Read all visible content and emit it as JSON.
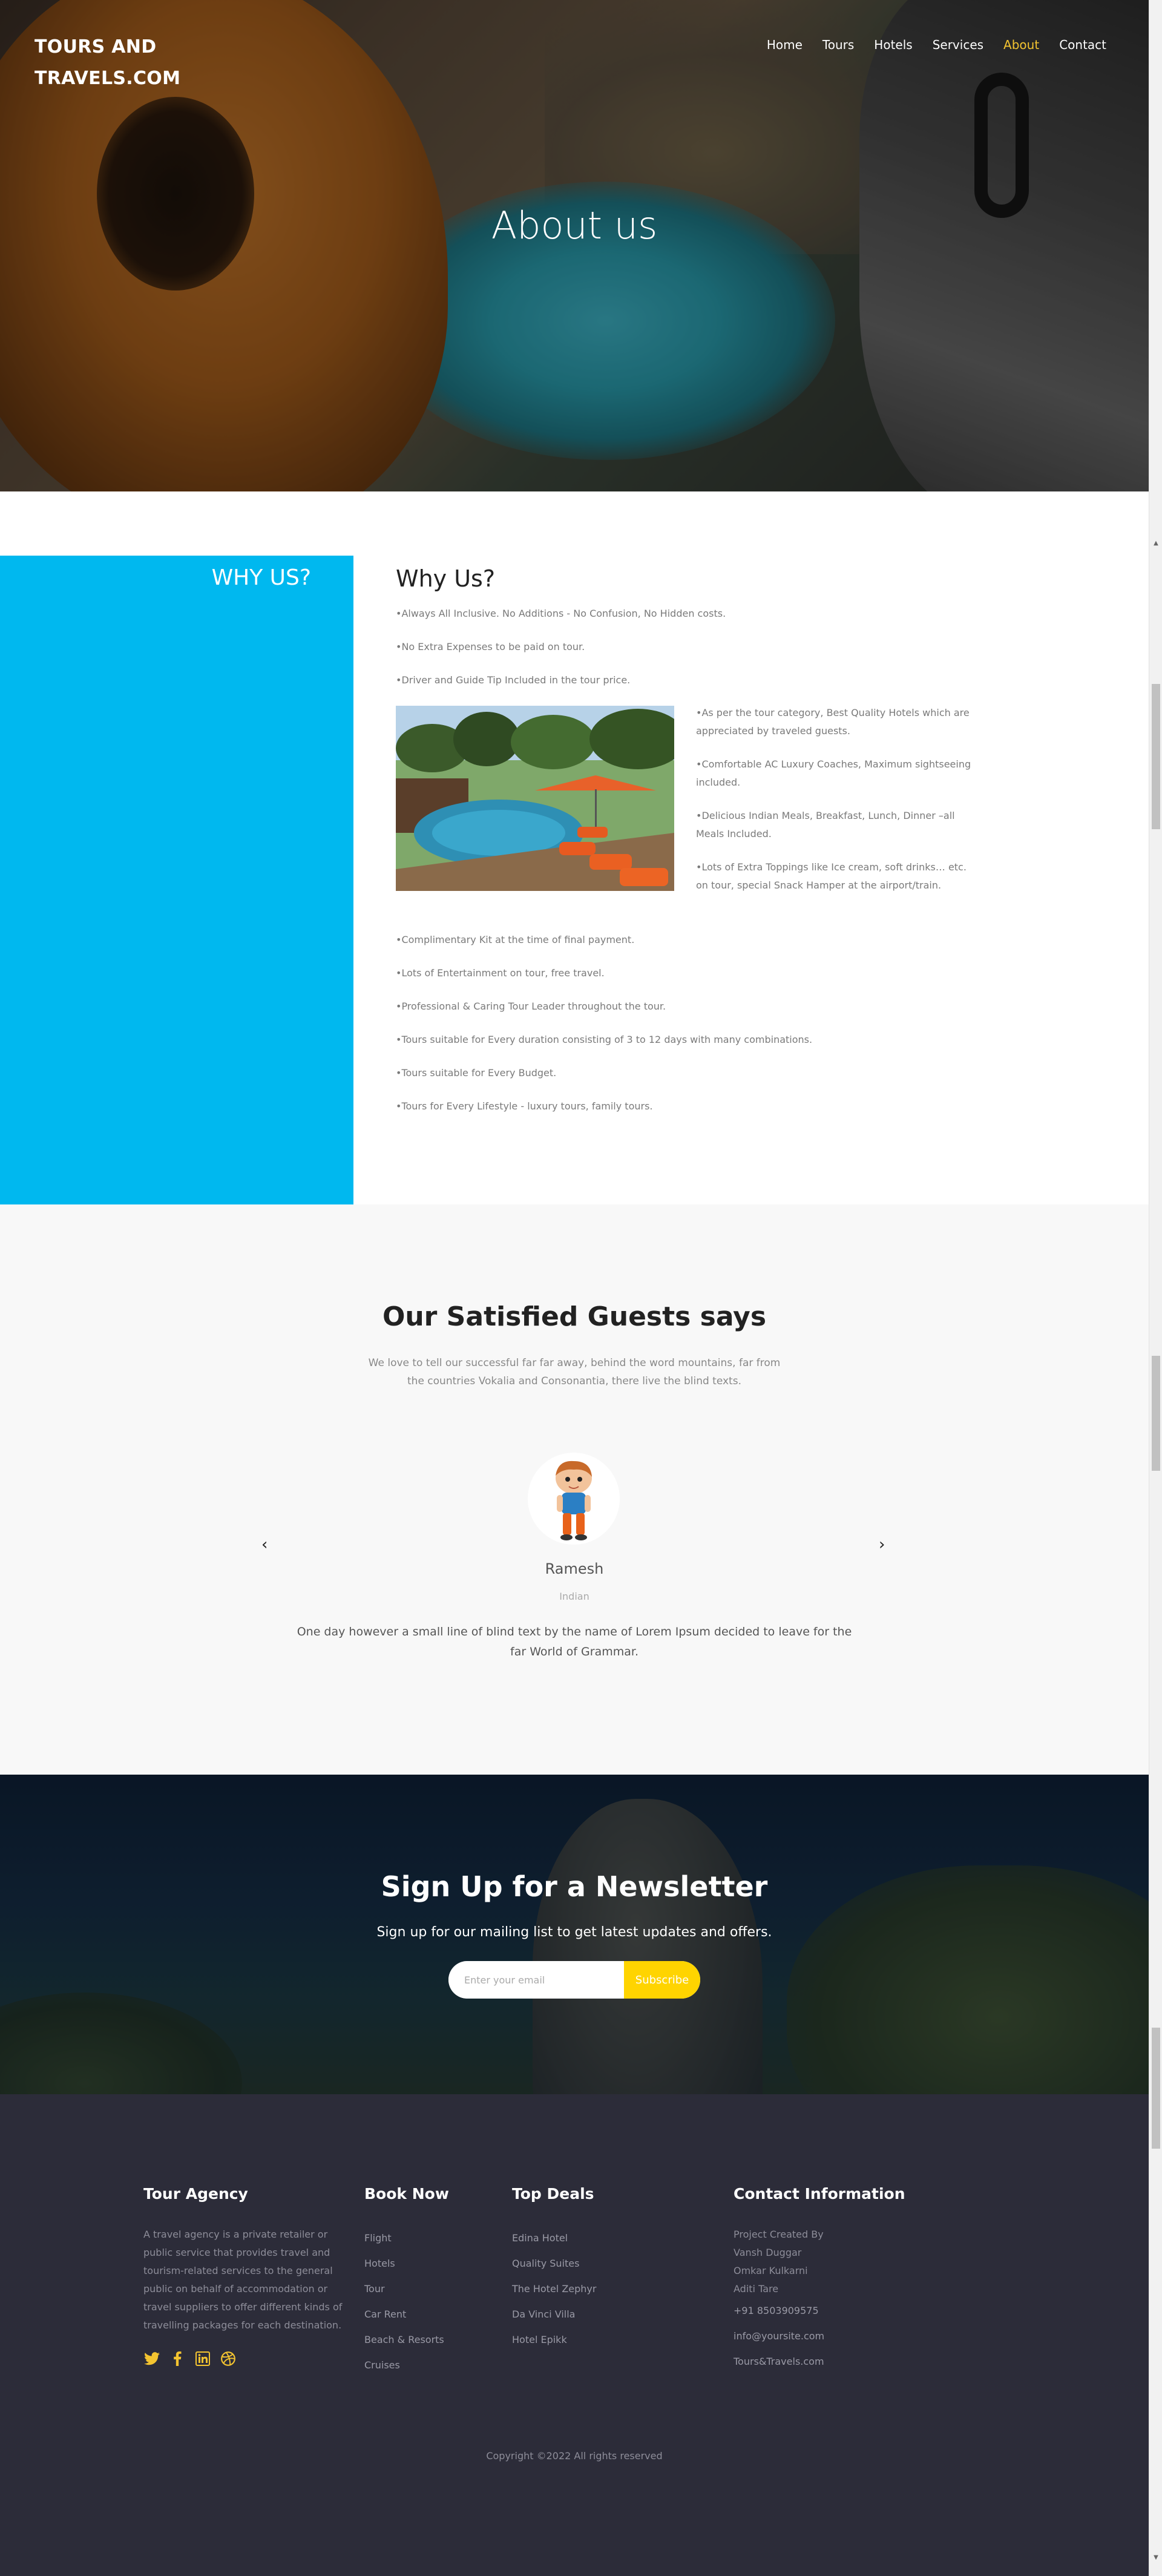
{
  "header": {
    "brand": "TOURS AND TRAVELS.COM",
    "nav": [
      "Home",
      "Tours",
      "Hotels",
      "Services",
      "About",
      "Contact"
    ],
    "active_nav": "About",
    "hero_title": "About us"
  },
  "why_us": {
    "side_title": "WHY US?",
    "title": "Why Us?",
    "list_top": [
      "•Always All Inclusive. No Additions - No Confusion, No Hidden costs.",
      "•No Extra Expenses to be paid on tour.",
      "•Driver and Guide Tip Included in the tour price."
    ],
    "list_side": [
      "•As per the tour category, Best Quality Hotels which are appreciated by traveled guests.",
      "•Comfortable AC Luxury Coaches, Maximum sightseeing included.",
      "•Delicious Indian Meals, Breakfast, Lunch, Dinner –all Meals Included.",
      "•Lots of Extra Toppings like Ice cream, soft drinks… etc. on tour, special Snack Hamper at the airport/train."
    ],
    "list_bottom": [
      "•Complimentary Kit at the time of final payment.",
      "•Lots of Entertainment on tour, free travel.",
      "•Professional & Caring Tour Leader throughout the tour.",
      "•Tours suitable for Every duration consisting of 3 to 12 days with many combinations.",
      "•Tours suitable for Every Budget.",
      "•Tours for Every Lifestyle - luxury tours, family tours."
    ]
  },
  "testimonial": {
    "title": "Our Satisfied Guests says",
    "subtitle": "We love to tell our successful far far away, behind the word mountains, far from the countries Vokalia and Consonantia, there live the blind texts.",
    "prev": "‹",
    "next": "›",
    "name": "Ramesh",
    "origin": "Indian",
    "quote": "One day however a small line of blind text by the name of Lorem Ipsum decided to leave for the far World of Grammar."
  },
  "newsletter": {
    "title": "Sign Up for a Newsletter",
    "subtitle": "Sign up for our mailing list to get latest updates and offers.",
    "placeholder": "Enter your email",
    "button": "Subscribe"
  },
  "footer": {
    "agency_title": "Tour Agency",
    "agency_text": "A travel agency is a private retailer or public service that provides travel and tourism-related services to the general public on behalf of accommodation or travel suppliers to offer different kinds of travelling packages for each destination.",
    "social_icons": [
      "twitter-icon",
      "facebook-icon",
      "linkedin-icon",
      "dribbble-icon"
    ],
    "book_title": "Book Now",
    "book_links": [
      "Flight",
      "Hotels",
      "Tour",
      "Car Rent",
      "Beach & Resorts",
      "Cruises"
    ],
    "deals_title": "Top Deals",
    "deals_links": [
      "Edina Hotel",
      "Quality Suites",
      "The Hotel Zephyr",
      "Da Vinci Villa",
      "Hotel Epikk"
    ],
    "contact_title": "Contact Information",
    "contact_lines": [
      "Project Created By",
      "Vansh Duggar",
      "Omkar Kulkarni",
      "Aditi Tare"
    ],
    "contact_items": [
      "+91 8503909575",
      "info@yoursite.com",
      "Tours&Travels.com"
    ],
    "copyright": "Copyright ©2022 All rights reserved"
  },
  "colors": {
    "accent_yellow": "#f4c430",
    "why_blue": "#00b8ef",
    "footer_bg": "#2c2c39",
    "subscribe_yellow": "#ffd400"
  }
}
